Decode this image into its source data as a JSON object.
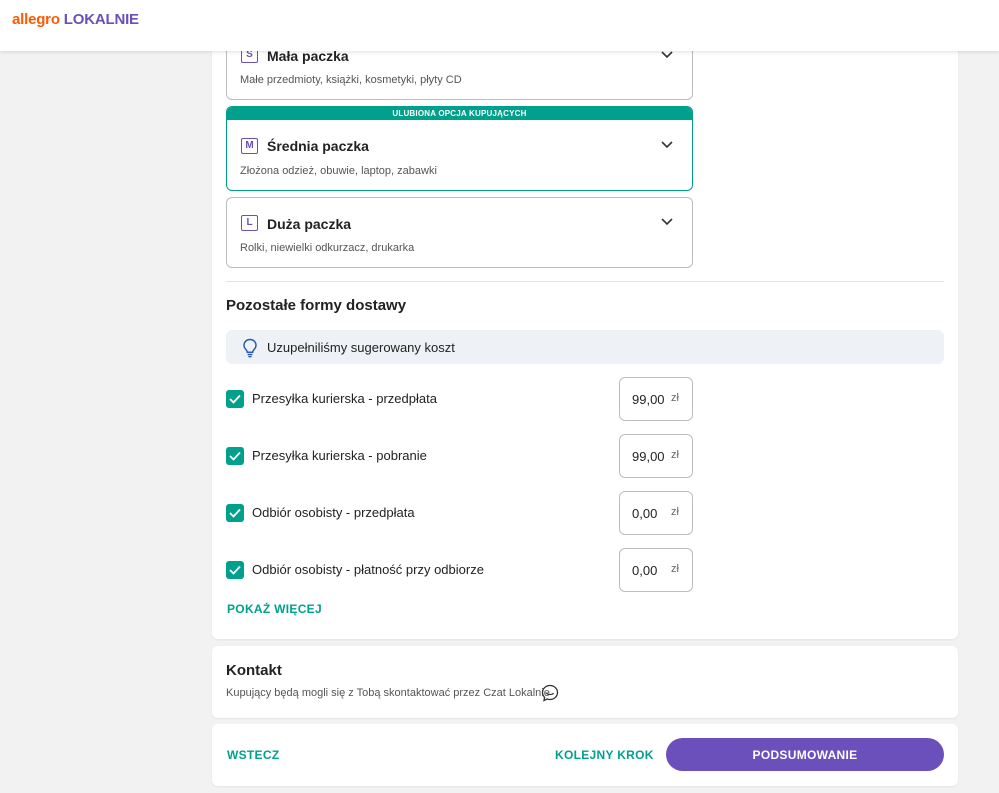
{
  "header": {
    "brand": "allegro",
    "sub": "LOKALNIE"
  },
  "packages": [
    {
      "size": "S",
      "title": "Mała paczka",
      "desc": "Małe przedmioty, książki, kosmetyki, płyty CD"
    },
    {
      "size": "M",
      "title": "Średnia paczka",
      "desc": "Złożona odzież, obuwie, laptop, zabawki",
      "banner": "ULUBIONA OPCJA KUPUJĄCYCH"
    },
    {
      "size": "L",
      "title": "Duża paczka",
      "desc": "Rolki, niewielki odkurzacz, drukarka"
    }
  ],
  "other": {
    "title": "Pozostałe formy dostawy",
    "info": "Uzupełniliśmy sugerowany koszt",
    "options": [
      {
        "label": "Przesyłka kurierska - przedpłata",
        "price": "99,00",
        "unit": "zł",
        "checked": true
      },
      {
        "label": "Przesyłka kurierska - pobranie",
        "price": "99,00",
        "unit": "zł",
        "checked": true
      },
      {
        "label": "Odbiór osobisty - przedpłata",
        "price": "0,00",
        "unit": "zł",
        "checked": true
      },
      {
        "label": "Odbiór osobisty - płatność przy odbiorze",
        "price": "0,00",
        "unit": "zł",
        "checked": true
      }
    ],
    "show_more": "POKAŻ WIĘCEJ"
  },
  "contact": {
    "title": "Kontakt",
    "desc": "Kupujący będą mogli się z Tobą skontaktować przez Czat Lokalnie"
  },
  "nav": {
    "back": "WSTECZ",
    "next": "KOLEJNY KROK",
    "summary": "PODSUMOWANIE"
  },
  "colors": {
    "accent": "#00a08c",
    "primary": "#6b4fbb",
    "brand": "#ff5a00"
  }
}
